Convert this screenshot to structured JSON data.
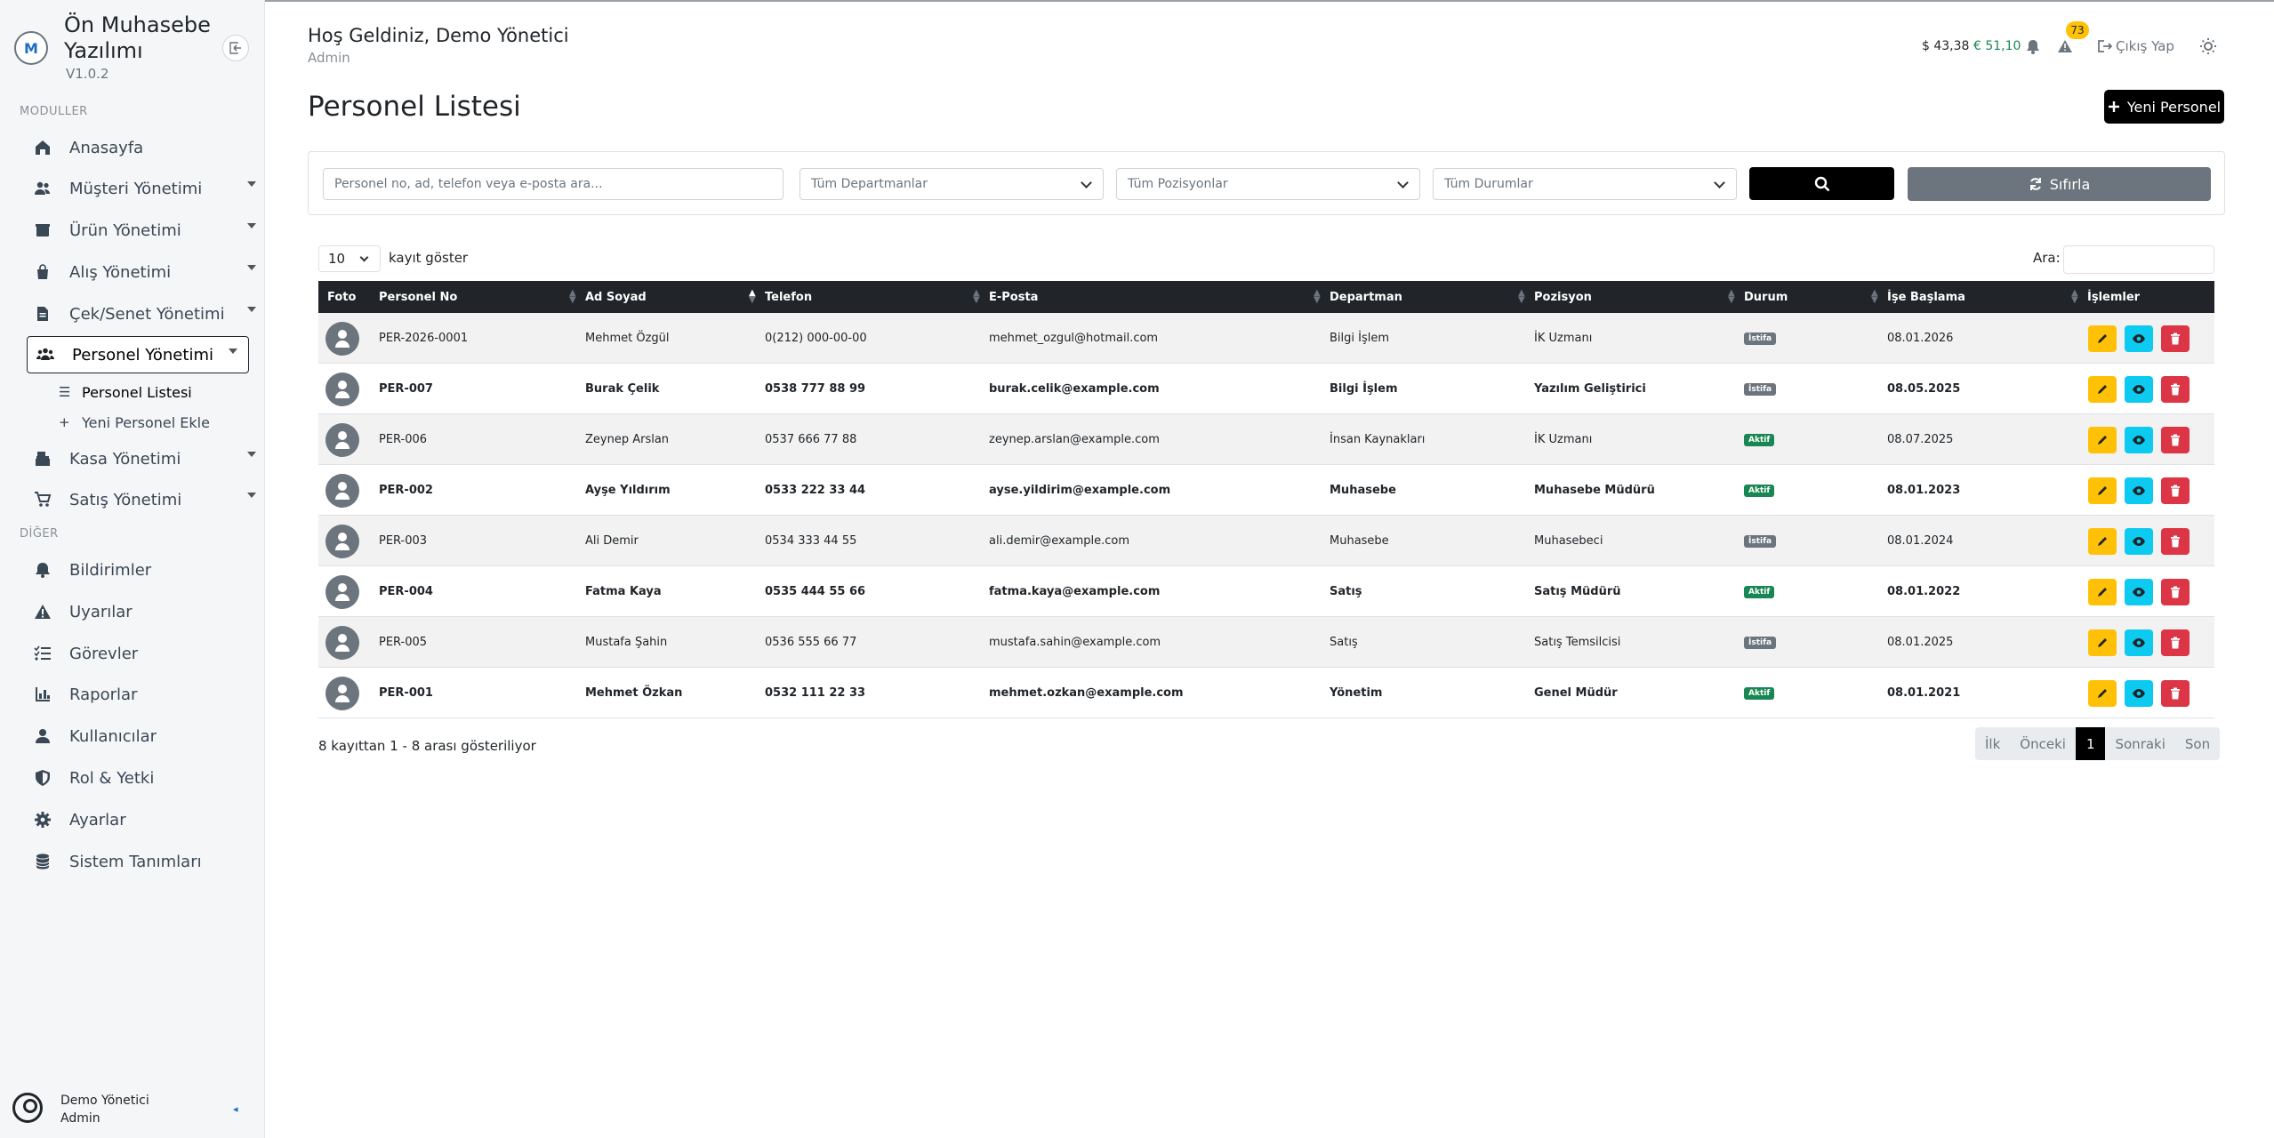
{
  "brand": {
    "title": "Ön Muhasebe Yazılımı",
    "version": "V1.0.2",
    "logo_letter": "M"
  },
  "sidebar": {
    "section_modules": "MODULLER",
    "section_other": "DİĞER",
    "items": [
      {
        "label": "Anasayfa",
        "icon": "home-icon"
      },
      {
        "label": "Müşteri Yönetimi",
        "icon": "users-icon"
      },
      {
        "label": "Ürün Yönetimi",
        "icon": "box-icon"
      },
      {
        "label": "Alış Yönetimi",
        "icon": "bag-icon"
      },
      {
        "label": "Çek/Senet Yönetimi",
        "icon": "file-invoice-icon"
      },
      {
        "label": "Personel Yönetimi",
        "icon": "people-icon"
      },
      {
        "label": "Kasa Yönetimi",
        "icon": "cash-register-icon"
      },
      {
        "label": "Satış Yönetimi",
        "icon": "cart-icon"
      }
    ],
    "sub_items": [
      {
        "label": "Personel Listesi",
        "icon": "list-icon"
      },
      {
        "label": "Yeni Personel Ekle",
        "icon": "plus-icon"
      }
    ],
    "other_items": [
      {
        "label": "Bildirimler",
        "icon": "bell-icon"
      },
      {
        "label": "Uyarılar",
        "icon": "warning-icon"
      },
      {
        "label": "Görevler",
        "icon": "tasks-icon"
      },
      {
        "label": "Raporlar",
        "icon": "chart-icon"
      },
      {
        "label": "Kullanıcılar",
        "icon": "user-icon"
      },
      {
        "label": "Rol & Yetki",
        "icon": "shield-icon"
      },
      {
        "label": "Ayarlar",
        "icon": "gear-icon"
      },
      {
        "label": "Sistem Tanımları",
        "icon": "database-icon"
      }
    ],
    "user": {
      "name": "Demo Yönetici",
      "role": "Admin"
    }
  },
  "header": {
    "welcome": "Hoş Geldiniz, Demo Yönetici",
    "role": "Admin",
    "usd": "$ 43,38",
    "eur": "€ 51,10",
    "alert_count": "73",
    "logout": "Çıkış Yap",
    "colors": {
      "usd": "#212529",
      "eur": "#198754",
      "badge": "#ffc107"
    }
  },
  "page": {
    "title": "Personel Listesi",
    "new_button": "Yeni Personel"
  },
  "filters": {
    "search_placeholder": "Personel no, ad, telefon veya e-posta ara...",
    "department": "Tüm Departmanlar",
    "position": "Tüm Pozisyonlar",
    "status": "Tüm Durumlar",
    "reset": "Sıfırla"
  },
  "table": {
    "length_value": "10",
    "length_label": "kayıt göster",
    "search_label": "Ara:",
    "columns": [
      "Foto",
      "Personel No",
      "Ad Soyad",
      "Telefon",
      "E-Posta",
      "Departman",
      "Pozisyon",
      "Durum",
      "İşe Başlama",
      "İşlemler"
    ],
    "rows": [
      {
        "no": "PER-2026-0001",
        "name": "Mehmet Özgül",
        "phone": "0(212) 000-00-00",
        "email": "mehmet_ozgul@hotmail.com",
        "dept": "Bilgi İşlem",
        "pos": "İK Uzmanı",
        "status": "İstifa",
        "start": "08.01.2026",
        "bold": false
      },
      {
        "no": "PER-007",
        "name": "Burak Çelik",
        "phone": "0538 777 88 99",
        "email": "burak.celik@example.com",
        "dept": "Bilgi İşlem",
        "pos": "Yazılım Geliştirici",
        "status": "İstifa",
        "start": "08.05.2025",
        "bold": true
      },
      {
        "no": "PER-006",
        "name": "Zeynep Arslan",
        "phone": "0537 666 77 88",
        "email": "zeynep.arslan@example.com",
        "dept": "İnsan Kaynakları",
        "pos": "İK Uzmanı",
        "status": "Aktif",
        "start": "08.07.2025",
        "bold": false
      },
      {
        "no": "PER-002",
        "name": "Ayşe Yıldırım",
        "phone": "0533 222 33 44",
        "email": "ayse.yildirim@example.com",
        "dept": "Muhasebe",
        "pos": "Muhasebe Müdürü",
        "status": "Aktif",
        "start": "08.01.2023",
        "bold": true
      },
      {
        "no": "PER-003",
        "name": "Ali Demir",
        "phone": "0534 333 44 55",
        "email": "ali.demir@example.com",
        "dept": "Muhasebe",
        "pos": "Muhasebeci",
        "status": "İstifa",
        "start": "08.01.2024",
        "bold": false
      },
      {
        "no": "PER-004",
        "name": "Fatma Kaya",
        "phone": "0535 444 55 66",
        "email": "fatma.kaya@example.com",
        "dept": "Satış",
        "pos": "Satış Müdürü",
        "status": "Aktif",
        "start": "08.01.2022",
        "bold": true
      },
      {
        "no": "PER-005",
        "name": "Mustafa Şahin",
        "phone": "0536 555 66 77",
        "email": "mustafa.sahin@example.com",
        "dept": "Satış",
        "pos": "Satış Temsilcisi",
        "status": "İstifa",
        "start": "08.01.2025",
        "bold": false
      },
      {
        "no": "PER-001",
        "name": "Mehmet Özkan",
        "phone": "0532 111 22 33",
        "email": "mehmet.ozkan@example.com",
        "dept": "Yönetim",
        "pos": "Genel Müdür",
        "status": "Aktif",
        "start": "08.01.2021",
        "bold": true
      }
    ],
    "info": "8 kayıttan 1 - 8 arası gösteriliyor",
    "pager": {
      "first": "İlk",
      "prev": "Önceki",
      "current": "1",
      "next": "Sonraki",
      "last": "Son"
    }
  }
}
